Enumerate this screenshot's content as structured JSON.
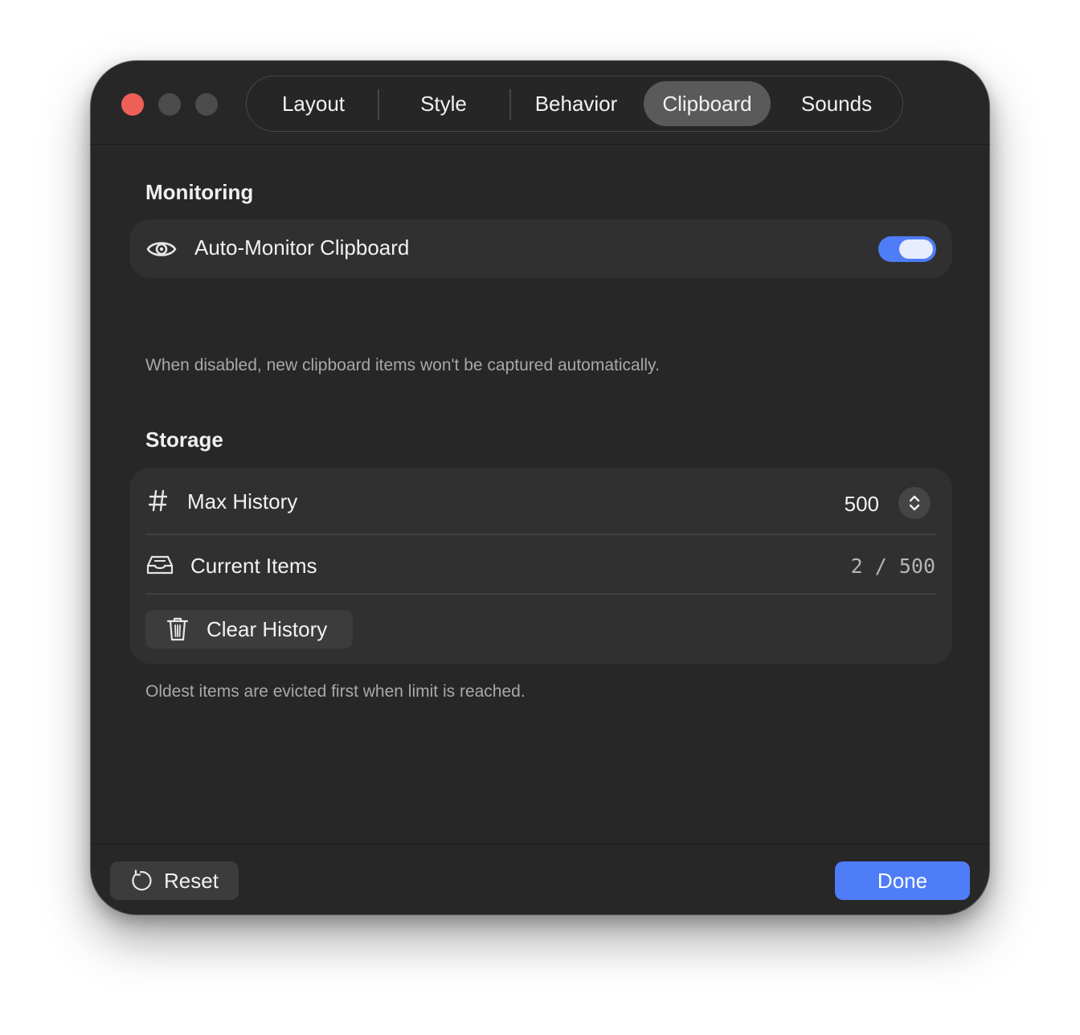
{
  "tabs": [
    {
      "label": "Layout",
      "active": false
    },
    {
      "label": "Style",
      "active": false
    },
    {
      "label": "Behavior",
      "active": false
    },
    {
      "label": "Clipboard",
      "active": true
    },
    {
      "label": "Sounds",
      "active": false
    }
  ],
  "monitoring": {
    "title": "Monitoring",
    "auto_monitor": {
      "icon": "eye-icon",
      "label": "Auto-Monitor Clipboard",
      "enabled": true
    },
    "hint": "When disabled, new clipboard items won't be captured automatically."
  },
  "storage": {
    "title": "Storage",
    "max_history": {
      "icon": "hash-icon",
      "label": "Max History",
      "value": "500"
    },
    "current_items": {
      "icon": "tray-icon",
      "label": "Current Items",
      "value": "2 / 500"
    },
    "clear_history": {
      "icon": "trash-icon",
      "label": "Clear History"
    },
    "hint": "Oldest items are evicted first when limit is reached."
  },
  "footer": {
    "reset_label": "Reset",
    "reset_icon": "reset-icon",
    "done_label": "Done"
  },
  "colors": {
    "accent": "#4f7cf7",
    "window_bg": "#272727",
    "card_bg": "#303030",
    "close_button": "#ee5f58"
  }
}
